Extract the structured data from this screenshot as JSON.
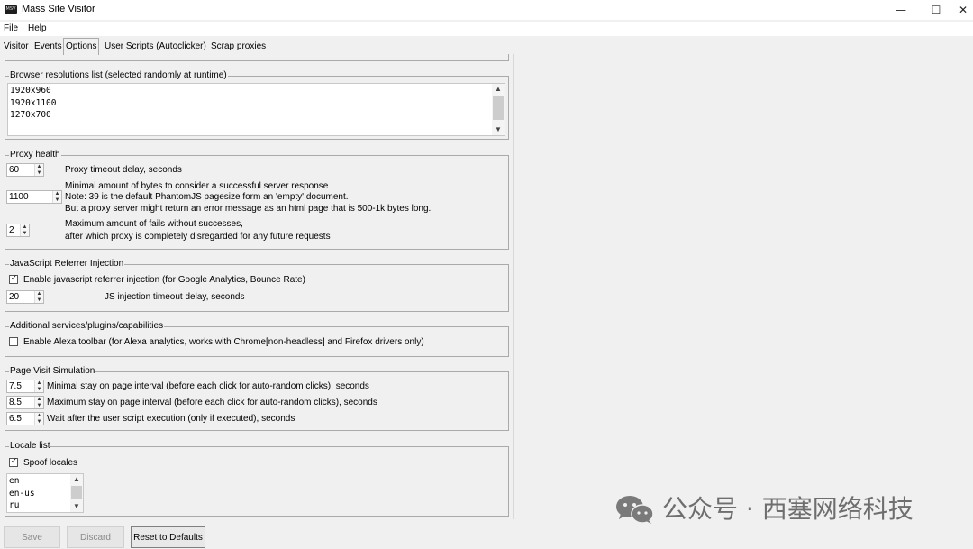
{
  "window": {
    "title": "Mass Site Visitor",
    "icon_label": "MSV",
    "minimize": "—",
    "maximize": "☐",
    "close": "✕"
  },
  "menu": {
    "file": "File",
    "help": "Help"
  },
  "tabs": [
    "Visitor",
    "Events",
    "Options",
    "User Scripts (Autoclicker)",
    "Scrap proxies"
  ],
  "active_tab": "Options",
  "resolutions": {
    "title": "Browser resolutions list (selected randomly at runtime)",
    "lines": [
      "1920x960",
      "1920x1100",
      "1270x700"
    ]
  },
  "proxy_health": {
    "title": "Proxy health",
    "timeout_value": "60",
    "timeout_label": "Proxy timeout delay, seconds",
    "min_bytes_value": "1100",
    "min_bytes_label_1": "Minimal amount of bytes to consider a successful server response",
    "min_bytes_label_2": "Note: 39 is the default PhantomJS pagesize form an 'empty' document.",
    "min_bytes_label_3": "But a proxy server might return an error message as an html page that is 500-1k bytes long.",
    "max_fails_value": "2",
    "max_fails_label_1": "Maximum amount of fails without successes,",
    "max_fails_label_2": "after which proxy is completely disregarded for any future requests"
  },
  "js_injection": {
    "title": "JavaScript Referrer Injection",
    "enable_checked": true,
    "enable_label": "Enable javascript referrer injection (for Google Analytics, Bounce Rate)",
    "timeout_value": "20",
    "timeout_label": "JS injection timeout delay, seconds"
  },
  "additional": {
    "title": "Additional services/plugins/capabilities",
    "alexa_checked": false,
    "alexa_label": "Enable Alexa toolbar (for Alexa analytics, works with Chrome[non-headless] and Firefox drivers only)"
  },
  "page_visit": {
    "title": "Page Visit Simulation",
    "min_stay_value": "7.5",
    "min_stay_label": "Minimal stay on page interval (before each click for auto-random clicks), seconds",
    "max_stay_value": "8.5",
    "max_stay_label": "Maximum stay on page interval (before each click for auto-random clicks), seconds",
    "wait_value": "6.5",
    "wait_label": "Wait after the user script execution (only if executed), seconds"
  },
  "locale": {
    "title": "Locale list",
    "spoof_checked": true,
    "spoof_label": "Spoof locales",
    "lines": [
      "en",
      "en-us",
      "ru"
    ]
  },
  "buttons": {
    "save": "Save",
    "discard": "Discard",
    "reset": "Reset to Defaults"
  },
  "watermark": {
    "text": "公众号 · 西塞网络科技",
    "icon": "wechat-icon"
  },
  "colors": {
    "background": "#f0f0f0",
    "watermark": "#6e6e6e"
  }
}
